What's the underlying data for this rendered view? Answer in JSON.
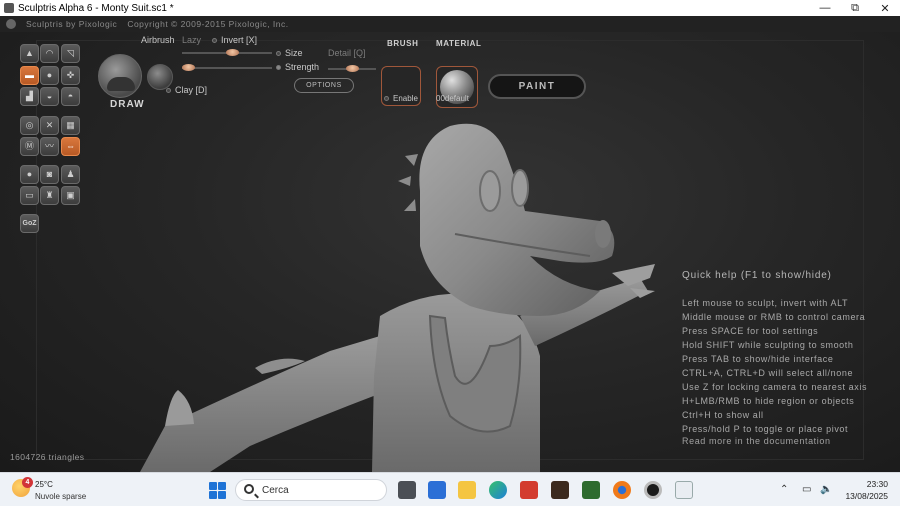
{
  "window": {
    "title": "Sculptris Alpha 6 - Monty Suit.sc1 *",
    "minimize": "—",
    "maximize": "⧉",
    "close": "✕"
  },
  "menubar": {
    "brand": "Sculptris by Pixologic",
    "copyright": "Copyright © 2009-2015 Pixologic, Inc."
  },
  "toolbox": {
    "goz_label": "GoZ"
  },
  "tool_options": {
    "tool_name": "DRAW",
    "airbrush": "Airbrush",
    "lazy": "Lazy",
    "invert": "Invert [X]",
    "size": "Size",
    "strength": "Strength",
    "detail": "Detail [Q]",
    "clay": "Clay [D]",
    "options_button": "OPTIONS"
  },
  "brush": {
    "heading": "BRUSH",
    "enable": "Enable"
  },
  "material": {
    "heading": "MATERIAL",
    "name": "00default"
  },
  "paint_button": "PAINT",
  "quick_help": {
    "title": "Quick help (F1 to show/hide)",
    "lines": [
      "Left mouse to sculpt, invert with ALT",
      "Middle mouse or RMB to control camera",
      "Press SPACE for tool settings",
      "Hold SHIFT while sculpting to smooth",
      "Press TAB to show/hide interface",
      "CTRL+A, CTRL+D will select all/none",
      "Use Z for locking camera to nearest axis",
      "H+LMB/RMB to hide region or objects",
      "Ctrl+H to show all",
      "Press/hold P to toggle or place pivot"
    ],
    "more": "Read more in the documentation"
  },
  "status": {
    "triangles": "1604726 triangles"
  },
  "taskbar": {
    "weather_badge": "4",
    "temperature": "25°C",
    "condition": "Nuvole sparse",
    "search_placeholder": "Cerca",
    "time": "23:30",
    "date": "13/08/2025"
  },
  "colors": {
    "accent_orange": "#d9773d",
    "viewport_bg": "#262626",
    "taskbar_bg": "#eef2f7"
  }
}
